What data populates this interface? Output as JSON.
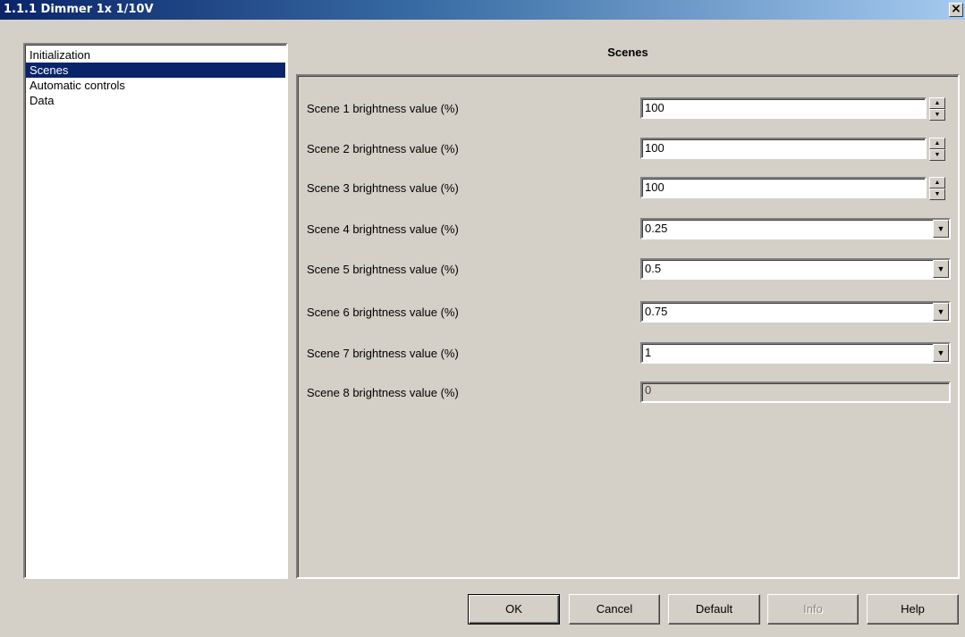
{
  "window": {
    "title": "1.1.1 Dimmer 1x 1/10V",
    "close_glyph": "×"
  },
  "tree": {
    "items": [
      {
        "label": "Initialization",
        "selected": false
      },
      {
        "label": "Scenes",
        "selected": true
      },
      {
        "label": "Automatic controls",
        "selected": false
      },
      {
        "label": "Data",
        "selected": false
      }
    ]
  },
  "panel": {
    "title": "Scenes",
    "rows": [
      {
        "label": "Scene 1 brightness value (%)",
        "value": "100",
        "control": "spinner"
      },
      {
        "label": "Scene 2 brightness value (%)",
        "value": "100",
        "control": "spinner"
      },
      {
        "label": "Scene 3 brightness value (%)",
        "value": "100",
        "control": "spinner"
      },
      {
        "label": "Scene 4 brightness value (%)",
        "value": "0.25",
        "control": "dropdown"
      },
      {
        "label": "Scene 5 brightness value (%)",
        "value": "0.5",
        "control": "dropdown"
      },
      {
        "label": "Scene 6 brightness value (%)",
        "value": "0.75",
        "control": "dropdown"
      },
      {
        "label": "Scene 7 brightness value (%)",
        "value": "1",
        "control": "dropdown"
      },
      {
        "label": "Scene 8 brightness value (%)",
        "value": "0",
        "control": "disabled"
      }
    ]
  },
  "buttons": {
    "ok": "OK",
    "cancel": "Cancel",
    "default": "Default",
    "info": "Info",
    "help": "Help"
  },
  "icons": {
    "spin_up": "up-arrow-icon",
    "spin_down": "down-arrow-icon",
    "dropdown": "chevron-down-icon"
  }
}
